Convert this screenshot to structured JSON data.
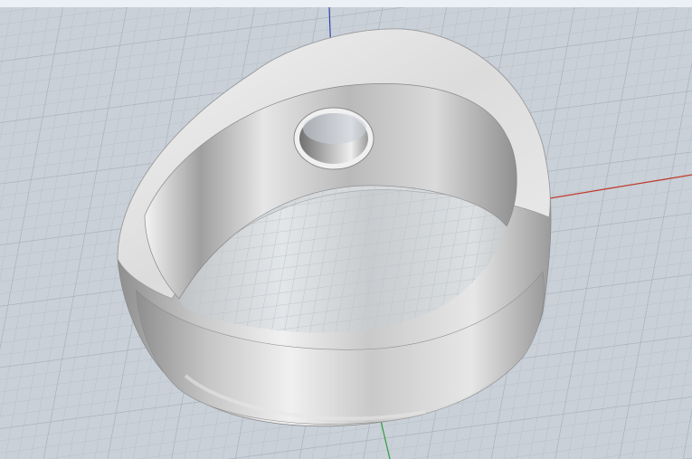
{
  "viewport": {
    "background_color": "#c9d0d8",
    "grid_color": "#aeb6bf",
    "grid_major_color": "#9aa3ad"
  },
  "axes": {
    "x_axis_color": "#c0392b",
    "y_axis_color": "#2e9e3e",
    "z_axis_color": "#3344aa"
  },
  "model": {
    "object_name": "ring-model",
    "material_color": "#b9b9b9",
    "has_signet_top": true,
    "has_center_hole": true
  }
}
